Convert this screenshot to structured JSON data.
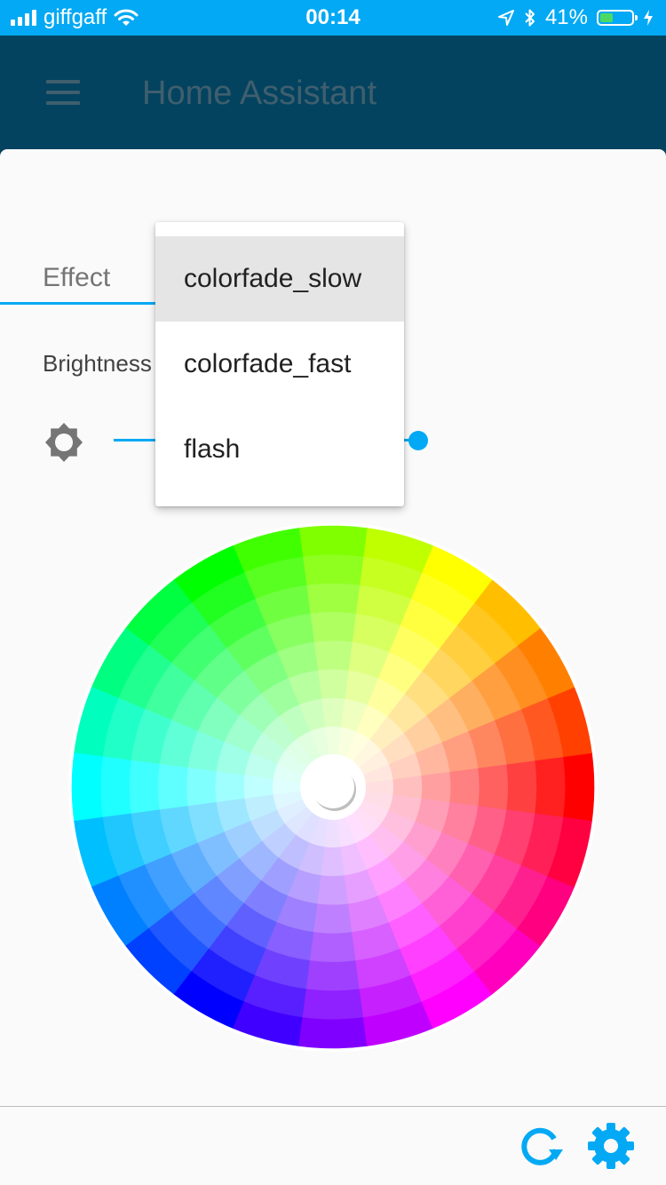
{
  "status_bar": {
    "carrier": "giffgaff",
    "time": "00:14",
    "battery_percent_label": "41%",
    "battery_level": 0.41
  },
  "toolbar": {
    "title": "Home Assistant"
  },
  "dialog": {
    "effect_label": "Effect",
    "brightness_label": "Brightness",
    "brightness_value": 0.99
  },
  "effect_menu": {
    "selected_index": 0,
    "items": [
      {
        "label": "colorfade_slow"
      },
      {
        "label": "colorfade_fast"
      },
      {
        "label": "flash"
      }
    ]
  },
  "colors": {
    "status_bar": "#03a9f4",
    "toolbar": "#04435f",
    "accent": "#03a9f4",
    "icon_gray": "#757575",
    "menu_highlight": "#e5e5e5"
  }
}
